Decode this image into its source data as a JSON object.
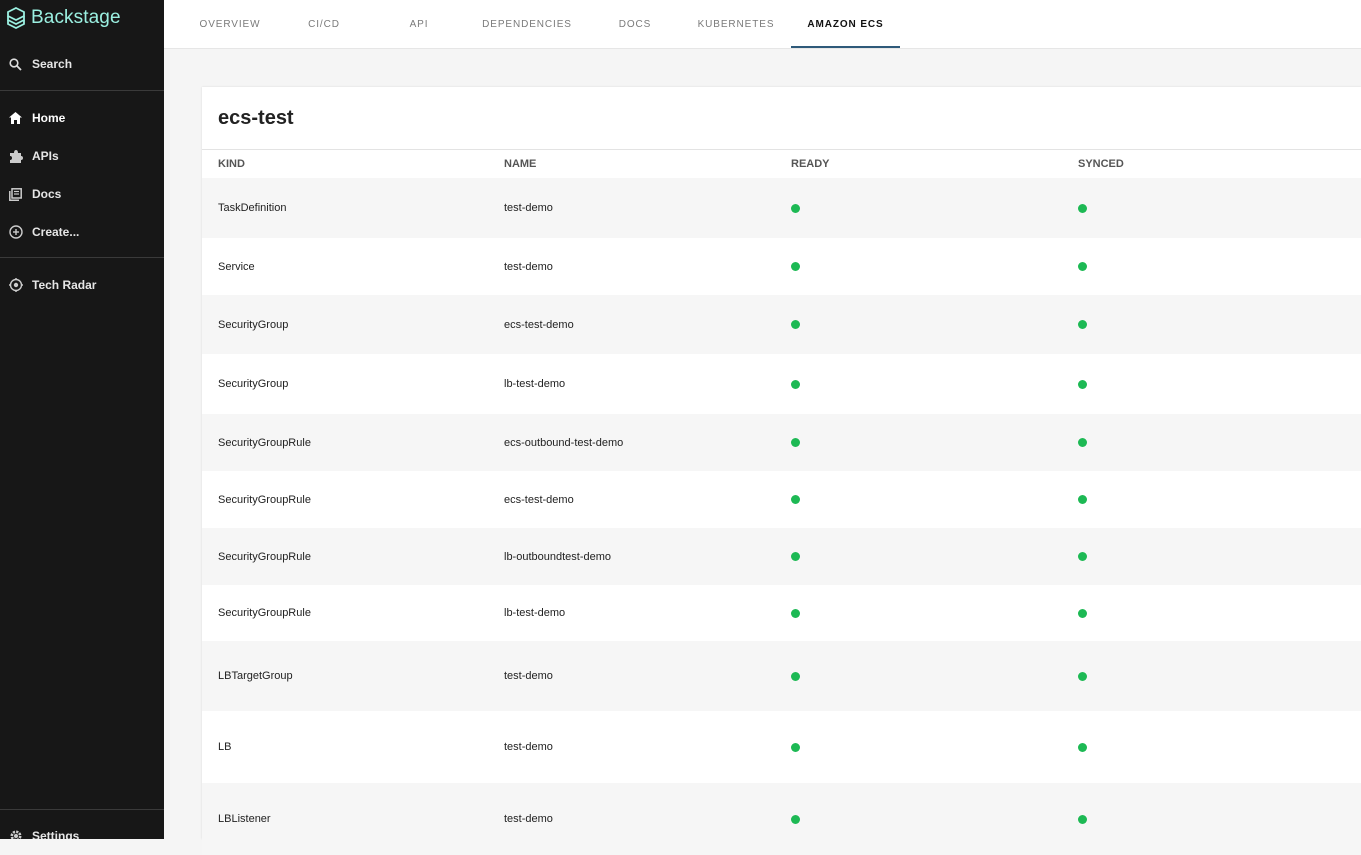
{
  "brand": {
    "name": "Backstage",
    "color": "#9bf0e1"
  },
  "sidebar": {
    "search_label": "Search",
    "items": [
      {
        "label": "Home",
        "icon": "home-icon"
      },
      {
        "label": "APIs",
        "icon": "puzzle-icon"
      },
      {
        "label": "Docs",
        "icon": "docs-icon"
      },
      {
        "label": "Create...",
        "icon": "plus-circle-icon"
      }
    ],
    "tech_radar_label": "Tech Radar",
    "settings_label": "Settings"
  },
  "tabs": [
    {
      "label": "OVERVIEW"
    },
    {
      "label": "CI/CD"
    },
    {
      "label": "API"
    },
    {
      "label": "DEPENDENCIES"
    },
    {
      "label": "DOCS"
    },
    {
      "label": "KUBERNETES"
    },
    {
      "label": "AMAZON ECS",
      "active": true
    }
  ],
  "card": {
    "title": "ecs-test",
    "columns": [
      "KIND",
      "NAME",
      "READY",
      "SYNCED"
    ],
    "status_color": "#1db954",
    "rows": [
      {
        "kind": "TaskDefinition",
        "name": "test-demo",
        "ready": true,
        "synced": true
      },
      {
        "kind": "Service",
        "name": "test-demo",
        "ready": true,
        "synced": true
      },
      {
        "kind": "SecurityGroup",
        "name": "ecs-test-demo",
        "ready": true,
        "synced": true
      },
      {
        "kind": "SecurityGroup",
        "name": "lb-test-demo",
        "ready": true,
        "synced": true
      },
      {
        "kind": "SecurityGroupRule",
        "name": "ecs-outbound-test-demo",
        "ready": true,
        "synced": true
      },
      {
        "kind": "SecurityGroupRule",
        "name": "ecs-test-demo",
        "ready": true,
        "synced": true
      },
      {
        "kind": "SecurityGroupRule",
        "name": "lb-outboundtest-demo",
        "ready": true,
        "synced": true
      },
      {
        "kind": "SecurityGroupRule",
        "name": "lb-test-demo",
        "ready": true,
        "synced": true
      },
      {
        "kind": "LBTargetGroup",
        "name": "test-demo",
        "ready": true,
        "synced": true
      },
      {
        "kind": "LB",
        "name": "test-demo",
        "ready": true,
        "synced": true
      },
      {
        "kind": "LBListener",
        "name": "test-demo",
        "ready": true,
        "synced": true
      }
    ]
  }
}
